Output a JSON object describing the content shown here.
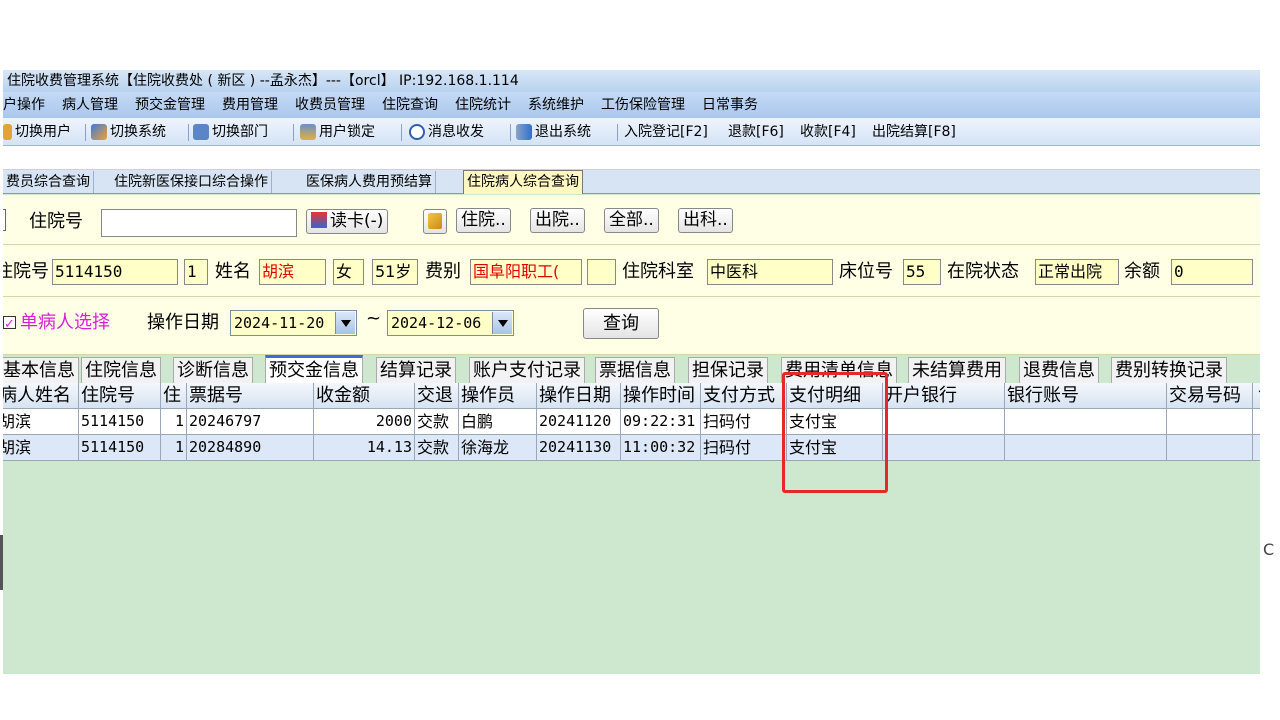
{
  "window": {
    "title": "住院收费管理系统【住院收费处 ( 新区 ) --孟永杰】---【orcl】 IP:192.168.1.114"
  },
  "menu": [
    "户操作",
    "病人管理",
    "预交金管理",
    "费用管理",
    "收费员管理",
    "住院查询",
    "住院统计",
    "系统维护",
    "工伤保险管理",
    "日常事务"
  ],
  "toolbar": {
    "switch_user": "切换用户",
    "switch_system": "切换系统",
    "switch_dept": "切换部门",
    "user_lock": "用户锁定",
    "messages": "消息收发",
    "exit": "退出系统",
    "admit": "入院登记[F2]",
    "refund": "退款[F6]",
    "charge": "收款[F4]",
    "discharge": "出院结算[F8]"
  },
  "module_tabs": [
    "费员综合查询",
    "住院新医保接口综合操作",
    "医保病人费用预结算",
    "住院病人综合查询"
  ],
  "search": {
    "label": "住院号",
    "value": "",
    "read_card": "读卡(-)",
    "btn_inpatient": "住院..",
    "btn_discharged": "出院..",
    "btn_all": "全部..",
    "btn_dept_out": "出科.."
  },
  "patient": {
    "hosp_no_label": "住院号",
    "hosp_no": "5114150",
    "times": "1",
    "name_label": "姓名",
    "name": "胡滨",
    "sex": "女",
    "age": "51岁",
    "fee_type_label": "费别",
    "fee_type": "国阜阳职工(",
    "dept_label": "住院科室",
    "dept": "中医科",
    "bed_label": "床位号",
    "bed": "55",
    "status_label": "在院状态",
    "status": "正常出院",
    "balance_label": "余额",
    "balance": "0"
  },
  "filter": {
    "single_patient": "单病人选择",
    "date_label": "操作日期",
    "date_from": "2024-11-20",
    "tilde": "~",
    "date_to": "2024-12-06",
    "query": "查询"
  },
  "detail_tabs": [
    "基本信息",
    "住院信息",
    "诊断信息",
    "预交金信息",
    "结算记录",
    "账户支付记录",
    "票据信息",
    "担保记录",
    "费用清单信息",
    "未结算费用",
    "退费信息",
    "费别转换记录"
  ],
  "table": {
    "headers": [
      "病人姓名",
      "住院号",
      "住",
      "票据号",
      "收金额",
      "交退",
      "操作员",
      "操作日期",
      "操作时间",
      "支付方式",
      "支付明细",
      "开户银行",
      "银行账号",
      "交易号码",
      "↑"
    ],
    "rows": [
      [
        "胡滨",
        "5114150",
        "1",
        "20246797",
        "2000",
        "交款",
        "白鹏",
        "20241120",
        "09:22:31",
        "扫码付",
        "支付宝",
        "",
        "",
        "",
        ""
      ],
      [
        "胡滨",
        "5114150",
        "1",
        "20284890",
        "14.13",
        "交款",
        "徐海龙",
        "20241130",
        "11:00:32",
        "扫码付",
        "支付宝",
        "",
        "",
        "",
        ""
      ]
    ]
  },
  "side_char": "C",
  "colors": {
    "highlight": "#e5282a",
    "panel": "#ffffe6",
    "grid_bg": "#cde8cf",
    "accent": "#3a6fd8"
  }
}
